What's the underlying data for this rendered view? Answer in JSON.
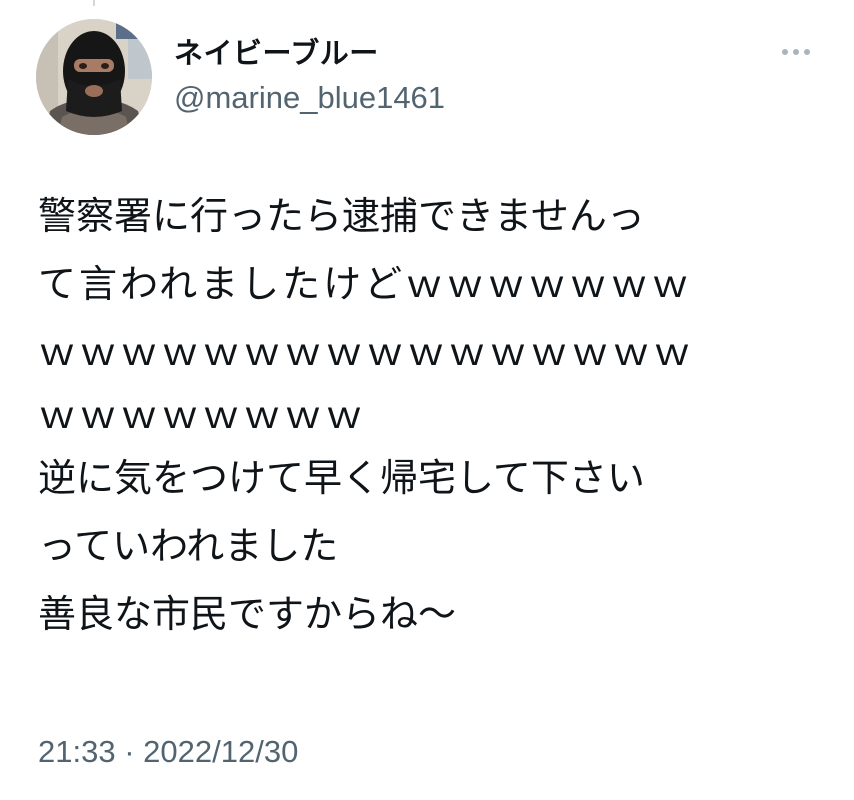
{
  "tweet": {
    "author": {
      "display_name": "ネイビーブルー",
      "handle": "@marine_blue1461",
      "avatar_icon": "balaclava-avatar"
    },
    "more_icon": "more-options-icon",
    "text_lines": [
      "警察署に行ったら逮捕できませんっ",
      "て言われましたけどｗｗｗｗｗｗｗ",
      "ｗｗｗｗｗｗｗｗｗｗｗｗｗｗｗｗ",
      "ｗｗｗｗｗｗｗｗ",
      "逆に気をつけて早く帰宅して下さい",
      "っていわれました",
      "善良な市民ですからね～"
    ],
    "time": "21:33",
    "separator": "·",
    "date": "2022/12/30"
  },
  "colors": {
    "text": "#0f1419",
    "secondary": "#536471",
    "background": "#ffffff"
  }
}
